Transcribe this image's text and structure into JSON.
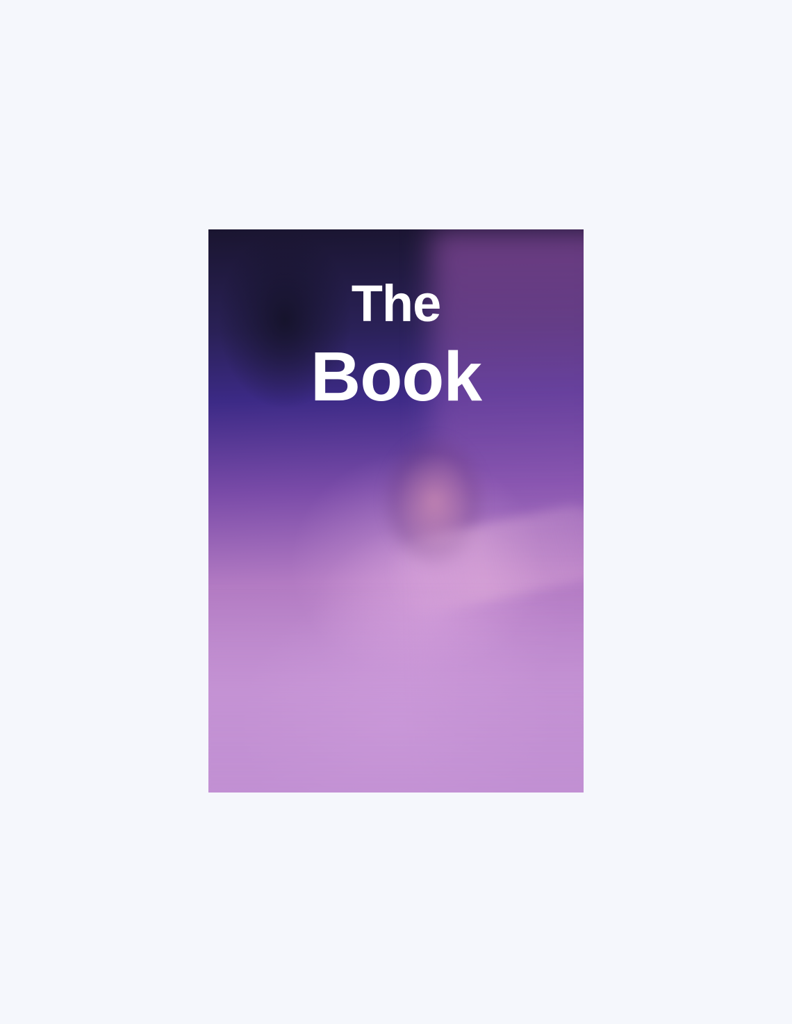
{
  "cover": {
    "title_line1": "The",
    "title_line2": "Book",
    "image": "veiled-portrait"
  },
  "colors": {
    "background": "#f5f7fc",
    "title": "#ffffff",
    "cover_dark": "#1a1530",
    "cover_light": "#bd8dd0"
  }
}
